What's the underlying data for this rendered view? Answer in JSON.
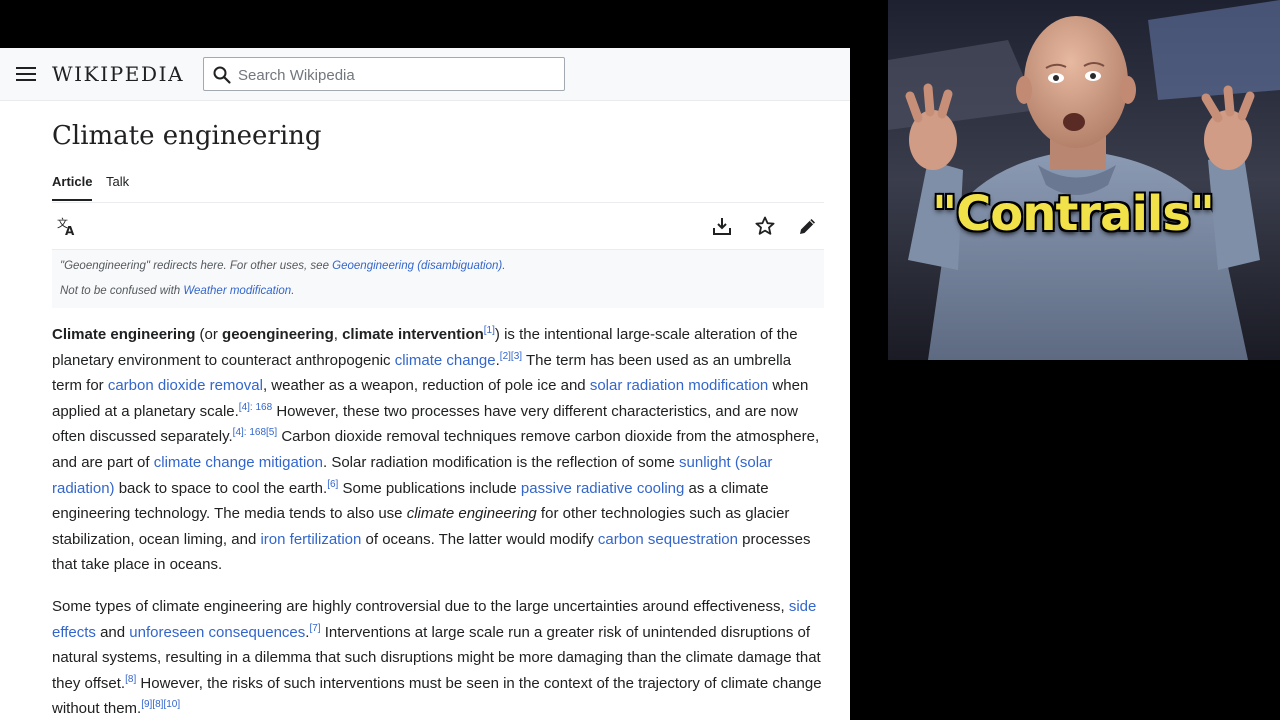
{
  "header": {
    "menu_icon": "hamburger-icon",
    "wordmark": "WIKIPEDIA",
    "search_placeholder": "Search Wikipedia"
  },
  "article": {
    "title": "Climate engineering",
    "tabs": [
      {
        "label": "Article",
        "active": true
      },
      {
        "label": "Talk",
        "active": false
      }
    ],
    "toolbar": [
      "translate-icon",
      "download-icon",
      "watch-star-icon",
      "edit-pencil-icon"
    ],
    "hatnotes": {
      "line1_prefix": "\"Geoengineering\" redirects here. For other uses, see ",
      "line1_link": "Geoengineering (disambiguation)",
      "line1_suffix": ".",
      "line2_prefix": "Not to be confused with ",
      "line2_link": "Weather modification",
      "line2_suffix": "."
    },
    "p1": {
      "b1": "Climate engineering",
      "t1": " (or ",
      "b2": "geoengineering",
      "t2": ", ",
      "b3": "climate intervention",
      "ref1": "[1]",
      "t3": ") is the intentional large-scale alteration of the planetary environment to counteract anthropogenic ",
      "l1": "climate change",
      "t4": ".",
      "ref2": "[2][3]",
      "t5": " The term has been used as an umbrella term for ",
      "l2": "carbon dioxide removal",
      "t6": ", weather as a weapon, reduction of pole ice and ",
      "l3": "solar radiation modification",
      "t7": " when applied at a planetary scale.",
      "ref3": "[4]: 168",
      "t8": " However, these two processes have very different characteristics, and are now often discussed separately.",
      "ref4": "[4]: 168[5]",
      "t9": " Carbon dioxide removal techniques remove carbon dioxide from the atmosphere, and are part of ",
      "l4": "climate change mitigation",
      "t10": ". Solar radiation modification is the reflection of some ",
      "l5": "sunlight (solar radiation)",
      "t11": " back to space to cool the earth.",
      "ref5": "[6]",
      "t12": " Some publications include ",
      "l6": "passive radiative cooling",
      "t13": " as a climate engineering technology. The media tends to also use ",
      "i1": "climate engineering",
      "t14": " for other technologies such as glacier stabilization, ocean liming, and ",
      "l7": "iron fertilization",
      "t15": " of oceans. The latter would modify ",
      "l8": "carbon sequestration",
      "t16": " processes that take place in oceans."
    },
    "p2": {
      "t1": "Some types of climate engineering are highly controversial due to the large uncertainties around effectiveness, ",
      "l1": "side effects",
      "t2": " and ",
      "l2": "unforeseen consequences",
      "t3": ".",
      "ref1": "[7]",
      "t4": " Interventions at large scale run a greater risk of unintended disruptions of natural systems, resulting in a dilemma that such disruptions might be more damaging than the climate damage that they offset.",
      "ref2": "[8]",
      "t5": " However, the risks of such interventions must be seen in the context of the trajectory of climate change without them.",
      "ref3": "[9][8][10]"
    }
  },
  "meme": {
    "caption": "\"Contrails\"",
    "colors": {
      "caption": "#f2e24a",
      "suit": "#7f8fa8"
    }
  },
  "colors": {
    "link": "#3366cc",
    "text": "#202122",
    "header_bg": "#f8f9fa"
  }
}
